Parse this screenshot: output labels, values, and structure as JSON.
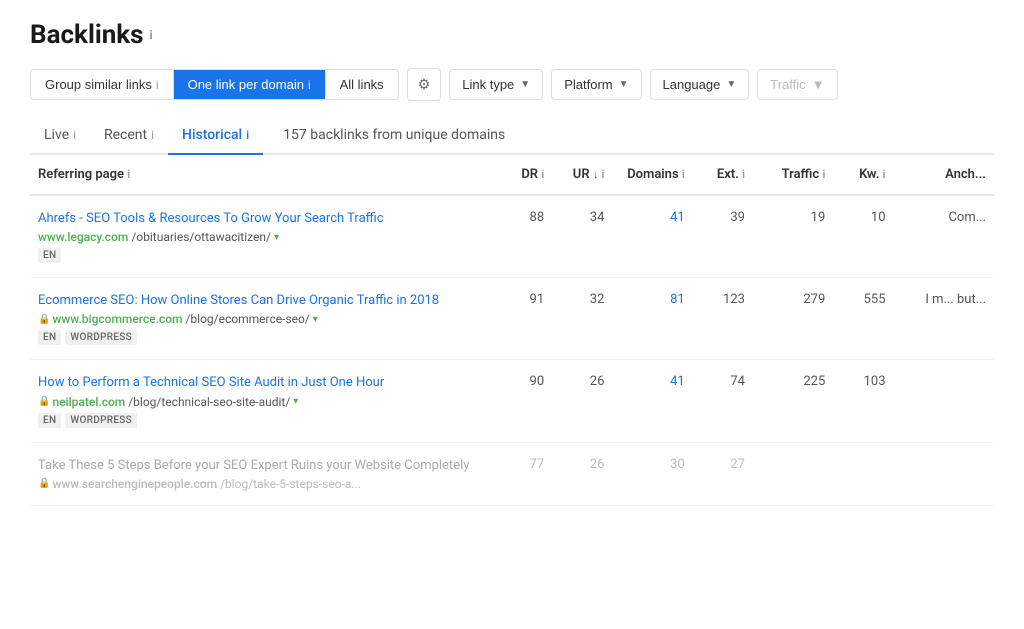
{
  "page": {
    "title": "Backlinks",
    "title_info": "i"
  },
  "toolbar": {
    "group_similar": "Group similar links",
    "group_similar_info": "i",
    "one_per_domain": "One link per domain",
    "one_per_domain_info": "i",
    "all_links": "All links",
    "link_type": "Link type",
    "platform": "Platform",
    "language": "Language",
    "traffic": "Traffic"
  },
  "tabs": [
    {
      "id": "live",
      "label": "Live",
      "active": false
    },
    {
      "id": "recent",
      "label": "Recent",
      "active": false
    },
    {
      "id": "historical",
      "label": "Historical",
      "active": true
    }
  ],
  "summary": "157 backlinks from unique domains",
  "table": {
    "columns": [
      {
        "id": "referring",
        "label": "Referring page",
        "has_info": true
      },
      {
        "id": "dr",
        "label": "DR",
        "has_info": true,
        "sortable": false
      },
      {
        "id": "ur",
        "label": "UR",
        "has_info": true,
        "sortable": true,
        "sort_dir": "desc"
      },
      {
        "id": "domains",
        "label": "Domains",
        "has_info": true
      },
      {
        "id": "ext",
        "label": "Ext.",
        "has_info": true
      },
      {
        "id": "traffic",
        "label": "Traffic",
        "has_info": true
      },
      {
        "id": "kw",
        "label": "Kw.",
        "has_info": true
      },
      {
        "id": "anch",
        "label": "Anch...",
        "has_info": false
      }
    ],
    "rows": [
      {
        "id": 1,
        "title": "Ahrefs - SEO Tools & Resources To Grow Your Search Traffic",
        "url_display": "www.legacy.com",
        "url_path": "/obituaries/ottawacitizen/",
        "has_lock": false,
        "has_chevron": true,
        "dr": "88",
        "ur": "34",
        "domains": "41",
        "ext": "39",
        "traffic": "19",
        "kw": "10",
        "anch": "Com...",
        "tags": [
          "EN"
        ],
        "faded": false,
        "domains_blue": true
      },
      {
        "id": 2,
        "title": "Ecommerce SEO: How Online Stores Can Drive Organic Traffic in 2018",
        "url_display": "www.bigcommerce.com",
        "url_path": "/blog/ecommerce-seo/",
        "has_lock": true,
        "has_chevron": true,
        "dr": "91",
        "ur": "32",
        "domains": "81",
        "ext": "123",
        "traffic": "279",
        "kw": "555",
        "anch": "I m... but...",
        "tags": [
          "EN",
          "WORDPRESS"
        ],
        "faded": false,
        "domains_blue": true
      },
      {
        "id": 3,
        "title": "How to Perform a Technical SEO Site Audit in Just One Hour",
        "url_display": "neilpatel.com",
        "url_path": "/blog/technical-seo-site-audit/",
        "has_lock": true,
        "has_chevron": true,
        "dr": "90",
        "ur": "26",
        "domains": "41",
        "ext": "74",
        "traffic": "225",
        "kw": "103",
        "anch": "",
        "tags": [
          "EN",
          "WORDPRESS"
        ],
        "faded": false,
        "domains_blue": true
      },
      {
        "id": 4,
        "title": "Take These 5 Steps Before your SEO Expert Ruins your Website Completely",
        "url_display": "www.searchenginepeople.com",
        "url_path": "/blog/take-5-steps-seo-a...",
        "has_lock": true,
        "has_chevron": false,
        "dr": "77",
        "ur": "26",
        "domains": "30",
        "ext": "27",
        "traffic": "",
        "kw": "",
        "anch": "",
        "tags": [],
        "faded": true,
        "domains_blue": false
      }
    ]
  }
}
